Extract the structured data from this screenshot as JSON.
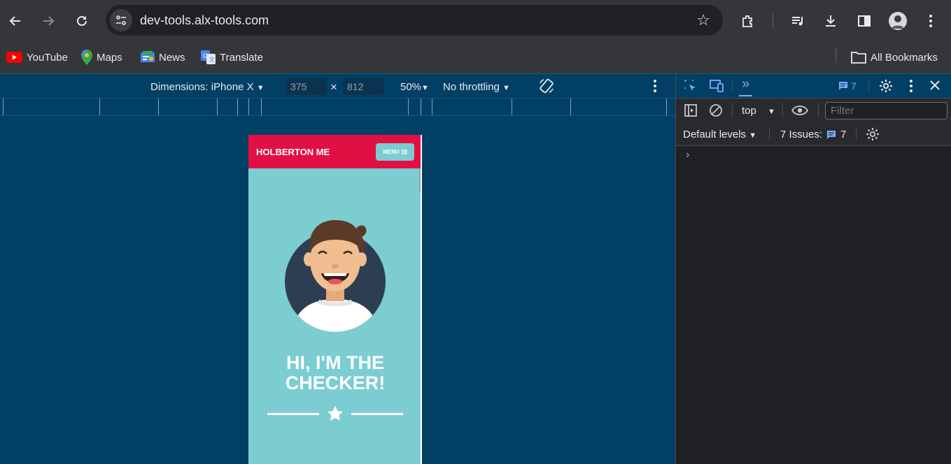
{
  "browser": {
    "url": "dev-tools.alx-tools.com",
    "bookmarks": [
      {
        "label": "YouTube",
        "icon": "youtube-icon"
      },
      {
        "label": "Maps",
        "icon": "maps-icon"
      },
      {
        "label": "News",
        "icon": "news-icon"
      },
      {
        "label": "Translate",
        "icon": "translate-icon"
      }
    ],
    "all_bookmarks": "All Bookmarks"
  },
  "device_toolbar": {
    "dimensions": "Dimensions: iPhone X",
    "width": "375",
    "height": "812",
    "times": "×",
    "zoom": "50%",
    "throttling": "No throttling"
  },
  "page": {
    "brand": "HOLBERTON ME",
    "menu": "MENU",
    "title_line1": "HI, I'M THE",
    "title_line2": "CHECKER!"
  },
  "devtools": {
    "messages_count": "7",
    "context": "top",
    "filter_placeholder": "Filter",
    "levels": "Default levels",
    "issues_label": "7 Issues:",
    "issues_count": "7"
  },
  "colors": {
    "accent": "#e20f44",
    "teal": "#7bcdd2",
    "devtools_blue": "#023f64"
  }
}
